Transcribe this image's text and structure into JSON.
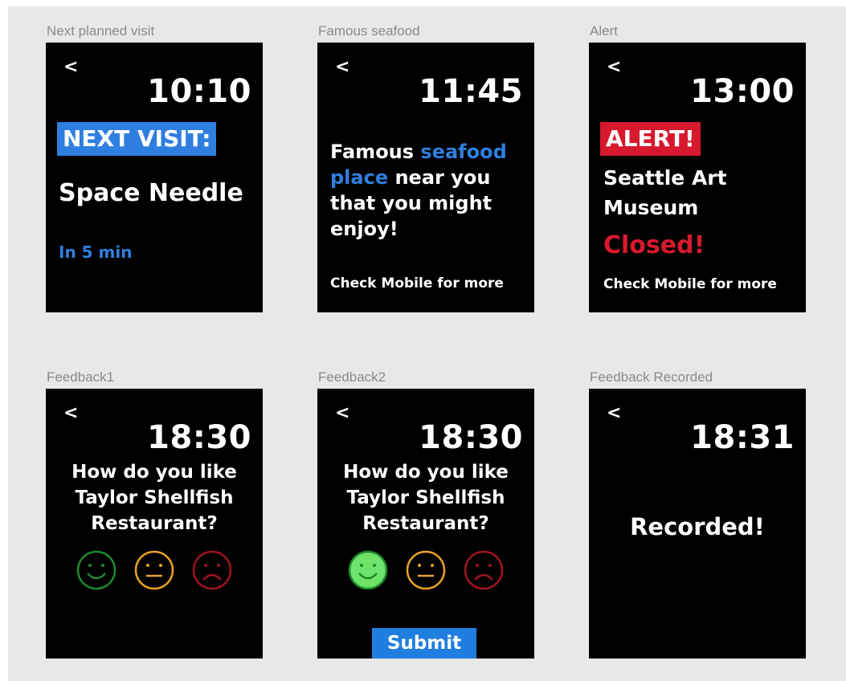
{
  "screens": {
    "next_visit": {
      "label": "Next planned visit",
      "back": "<",
      "time": "10:10",
      "badge": "NEXT VISIT:",
      "place": "Space Needle",
      "eta": "In 5 min"
    },
    "seafood": {
      "label": "Famous seafood",
      "back": "<",
      "time": "11:45",
      "line1_pre": "Famous ",
      "line1_accent": "seafood",
      "line2_accent": "place",
      "line2_post": " near you",
      "line3": "that you might",
      "line4": "enjoy!",
      "footer": "Check Mobile for more"
    },
    "alert": {
      "label": "Alert",
      "back": "<",
      "time": "13:00",
      "badge": "ALERT!",
      "place_line1": "Seattle Art",
      "place_line2": "Museum",
      "status": "Closed!",
      "footer": "Check Mobile for more"
    },
    "feedback1": {
      "label": "Feedback1",
      "back": "<",
      "time": "18:30",
      "q1": "How do you like",
      "q2": "Taylor Shellfish",
      "q3": "Restaurant?"
    },
    "feedback2": {
      "label": "Feedback2",
      "back": "<",
      "time": "18:30",
      "q1": "How do you like",
      "q2": "Taylor Shellfish",
      "q3": "Restaurant?",
      "submit": "Submit"
    },
    "recorded": {
      "label": "Feedback Recorded",
      "back": "<",
      "time": "18:31",
      "message": "Recorded!"
    }
  },
  "faces": {
    "happy_icon": "happy-face-icon",
    "neutral_icon": "neutral-face-icon",
    "sad_icon": "sad-face-icon",
    "happy_color": "#1f8a2b",
    "neutral_color": "#e9a227",
    "sad_color": "#a0141f",
    "happy_selected_fill": "#6ee36a"
  },
  "colors": {
    "accent": "#2f7fe0",
    "alert": "#d7192d",
    "screen_bg": "#000000",
    "canvas_bg": "#e8e8e8"
  }
}
